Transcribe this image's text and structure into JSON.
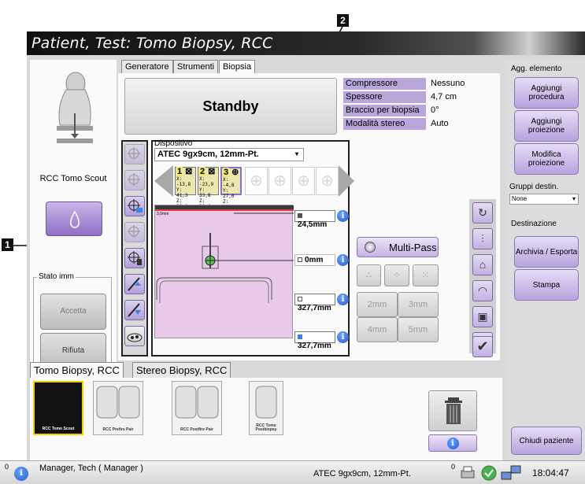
{
  "window": {
    "title": "Patient, Test: Tomo Biopsy, RCC"
  },
  "callouts": {
    "c1": "1",
    "c2": "2"
  },
  "left_panel": {
    "view_label": "RCC Tomo Scout",
    "image_state_label": "Stato imm",
    "accept_label": "Accetta",
    "reject_label": "Rifiuta"
  },
  "tabs": [
    {
      "label": "Generatore"
    },
    {
      "label": "Strumenti"
    },
    {
      "label": "Biopsia"
    }
  ],
  "status_button": "Standby",
  "info_table": [
    {
      "label": "Compressore",
      "value": "Nessuno"
    },
    {
      "label": "Spessore",
      "value": "4,7 cm"
    },
    {
      "label": "Braccio per biopsia",
      "value": "0°"
    },
    {
      "label": "Modalità stereo",
      "value": "Auto"
    }
  ],
  "device": {
    "label": "Dispositivo",
    "selected": "ATEC 9gx9cm, 12mm-Pt."
  },
  "targets": [
    {
      "num": "1",
      "x": "X: -13,8",
      "y": "Y: 41,3",
      "z": "Z: 38,0"
    },
    {
      "num": "2",
      "x": "X: -23,9",
      "y": "Y: 33,8",
      "z": "Z: 38,0"
    },
    {
      "num": "3",
      "x": "X: -4,8",
      "y": "Y: 27,0",
      "z": "Z: 38,0"
    }
  ],
  "diagram": {
    "scale_label": "3,0mm"
  },
  "measurements": [
    "24,5mm",
    "0mm",
    "327,7mm",
    "327,7mm"
  ],
  "multipass": {
    "label": "Multi-Pass",
    "step_buttons": [
      "2mm",
      "3mm",
      "4mm",
      "5mm"
    ]
  },
  "right_panel": {
    "add_element_label": "Agg. elemento",
    "add_procedure": "Aggiungi procedura",
    "add_projection": "Aggiungi proiezione",
    "edit_projection": "Modifica proiezione",
    "target_groups_label": "Gruppi destin.",
    "target_groups_value": "None",
    "destination_label": "Destinazione",
    "archive_export": "Archivia / Esporta",
    "print": "Stampa",
    "close_patient": "Chiudi paziente"
  },
  "procedure_tabs": [
    {
      "label": "Tomo Biopsy, RCC"
    },
    {
      "label": "Stereo Biopsy, RCC"
    }
  ],
  "thumbnails": [
    {
      "caption": "RCC Tomo Scout"
    },
    {
      "caption": "RCC Prefire Pair"
    },
    {
      "caption": "RCC Postfire Pair"
    },
    {
      "caption": "RCC Tomo Postbiopsy"
    }
  ],
  "status_bar": {
    "count_left": "0",
    "user": "Manager, Tech ( Manager )",
    "device": "ATEC 9gx9cm, 12mm-Pt.",
    "count_right": "0",
    "time": "18:04:47"
  },
  "colors": {
    "accent_purple": "#b9a7dc",
    "target_yellow": "#ece7ae",
    "diagram_pink": "#e9c9ea"
  }
}
